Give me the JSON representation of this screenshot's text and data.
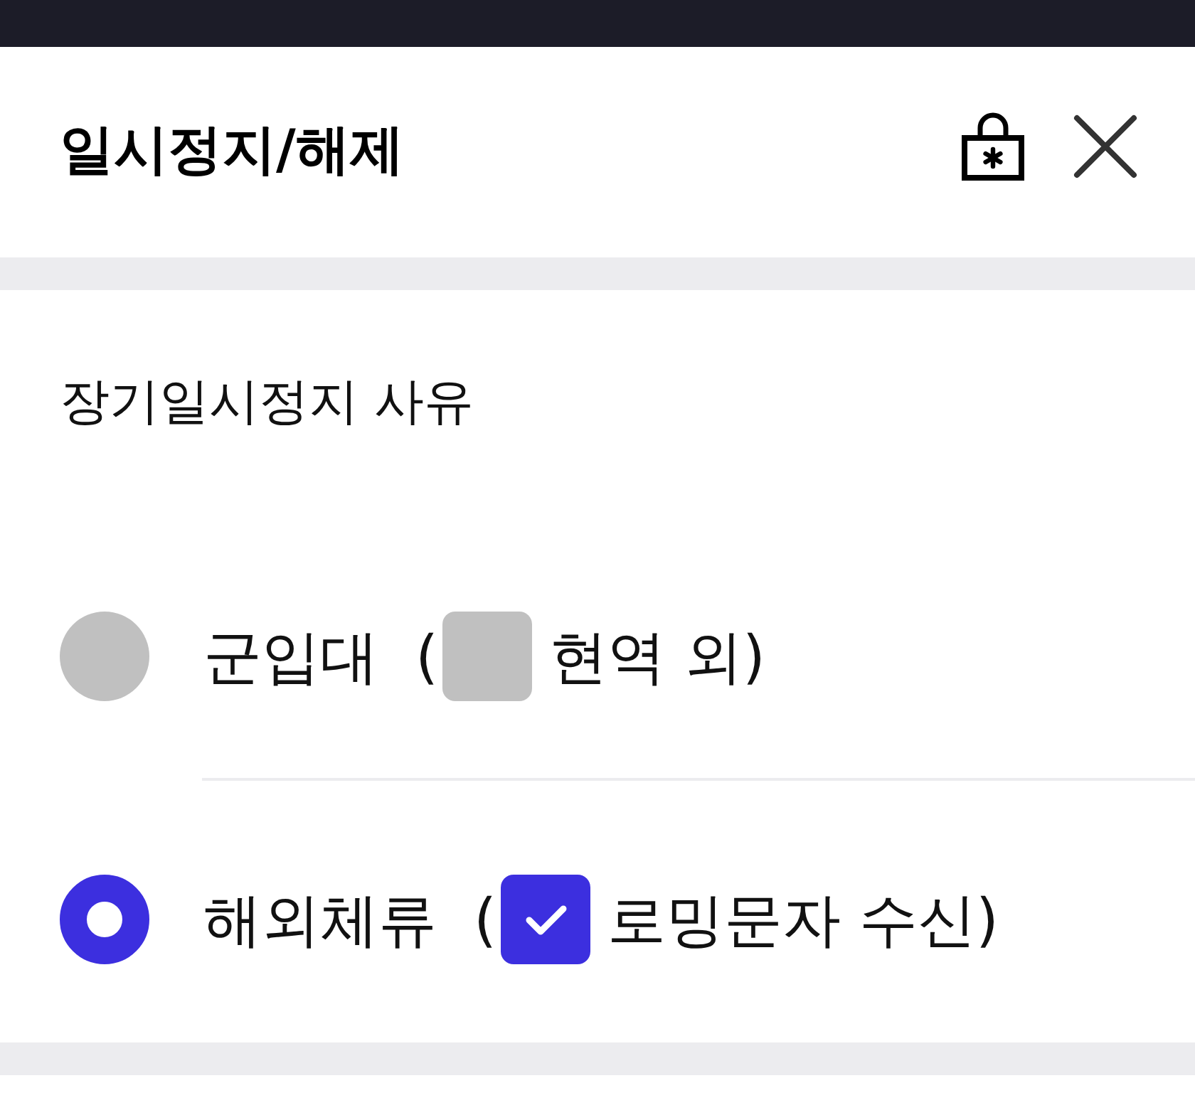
{
  "header": {
    "title": "일시정지/해제"
  },
  "reason": {
    "label": "장기일시정지 사유",
    "options": [
      {
        "label": "군입대",
        "selected": false,
        "open": "(",
        "checkbox": {
          "label": "현역 외",
          "checked": false,
          "disabled": true
        },
        "close": ")"
      },
      {
        "label": "해외체류",
        "selected": true,
        "open": "(",
        "checkbox": {
          "label": "로밍문자 수신",
          "checked": true,
          "disabled": false
        },
        "close": ")"
      }
    ]
  }
}
